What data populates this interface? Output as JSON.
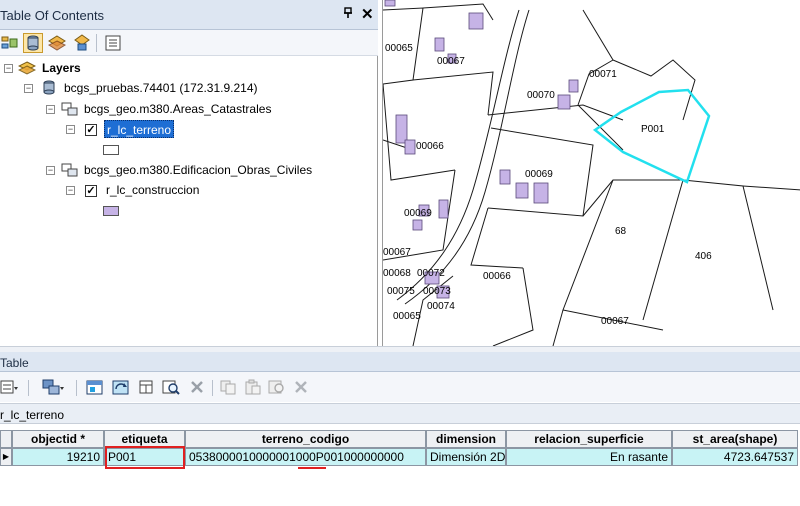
{
  "toc": {
    "title": "Table Of Contents",
    "pin_glyph": "ᵖ",
    "close_glyph": "✕",
    "layers_label": "Layers",
    "database": "bcgs_pruebas.74401 (172.31.9.214)",
    "groups": [
      {
        "name": "bcgs_geo.m380.Areas_Catastrales",
        "layer": "r_lc_terreno",
        "checked": true,
        "selected": true,
        "symbol_fill": "#ffffff"
      },
      {
        "name": "bcgs_geo.m380.Edificacion_Obras_Civiles",
        "layer": "r_lc_construccion",
        "checked": true,
        "selected": false,
        "symbol_fill": "#c6b3e6"
      }
    ]
  },
  "map": {
    "parcel_labels": [
      "00065",
      "00067",
      "00071",
      "00070",
      "P001",
      "00066",
      "00069",
      "00069",
      "68",
      "406",
      "00067",
      "00068",
      "00072",
      "00075",
      "00073",
      "00074",
      "00066",
      "00065",
      "00067"
    ],
    "highlight_color": "#22e0ee",
    "building_color": "#c6b3e6"
  },
  "table": {
    "title": "Table",
    "tab_name": "r_lc_terreno",
    "columns": [
      "objectid *",
      "etiqueta",
      "terreno_codigo",
      "dimension",
      "relacion_superficie",
      "st_area(shape)"
    ],
    "row": {
      "objectid": "19210",
      "etiqueta": "P001",
      "terreno_codigo": "0538000010000001000P001000000000",
      "dimension": "Dimensión 2D",
      "relacion_superficie": "En rasante",
      "st_area": "4723.647537"
    },
    "row_marker": "▶"
  }
}
